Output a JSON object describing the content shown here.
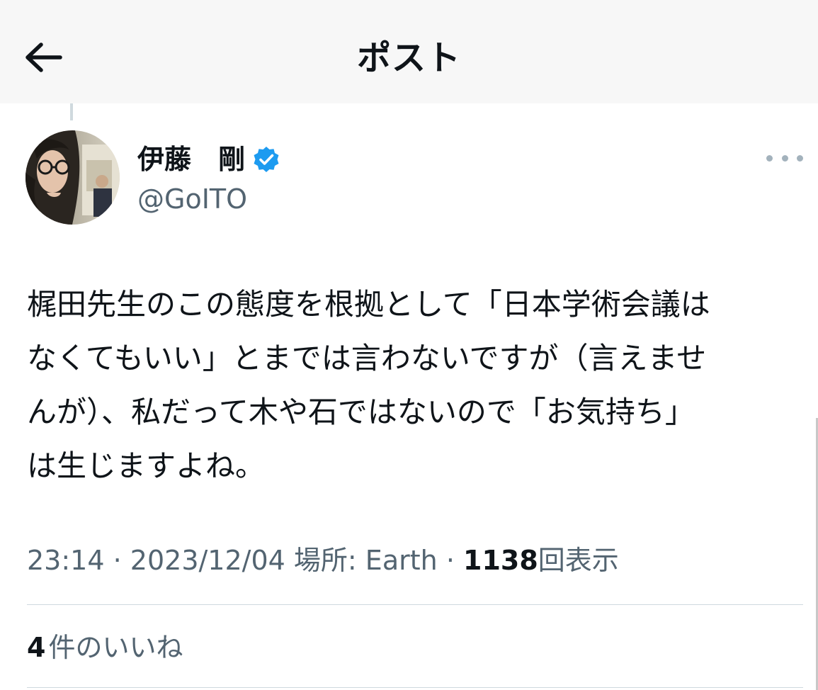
{
  "header": {
    "title": "ポスト",
    "back_icon": "arrow-left-icon"
  },
  "author": {
    "display_name": "伊藤　剛",
    "handle": "@GoITO",
    "verified": true,
    "verified_color": "#1d9bf0"
  },
  "post": {
    "text_lines": [
      "梶田先生のこの態度を根拠として「日本学術会議は",
      "なくてもいい」とまでは言わないですが（言えませ",
      "んが）、私だって木や石ではないので「お気持ち」",
      "は生じますよね。"
    ],
    "time": "23:14",
    "separator": "·",
    "date": "2023/12/04",
    "location": "場所: Earth",
    "views_count": "1138",
    "views_label": "回表示"
  },
  "stats": {
    "likes_count": "4",
    "likes_label": "件のいいね"
  },
  "colors": {
    "text_primary": "#0f1419",
    "text_secondary": "#536471",
    "divider": "#cfd9de",
    "header_bg": "#f7f7f7"
  }
}
